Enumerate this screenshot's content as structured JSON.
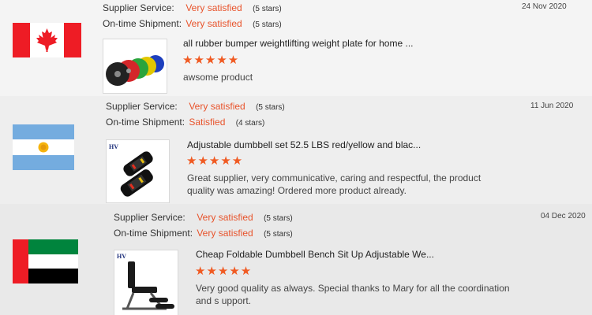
{
  "reviews": [
    {
      "country": "Canada",
      "supplier_label": "Supplier Service:",
      "supplier_value": "Very satisfied",
      "supplier_stars": "(5 stars)",
      "shipment_label": "On-time Shipment:",
      "shipment_value": "Very satisfied",
      "shipment_stars": "(5 stars)",
      "date": "24 Nov 2020",
      "product_title": "all rubber bumper weightlifting weight plate for home ...",
      "rating_stars": "★★★★★",
      "comment": "awsome product",
      "thumb_icon": "weight-plates"
    },
    {
      "country": "Argentina",
      "supplier_label": "Supplier Service:",
      "supplier_value": "Very satisfied",
      "supplier_stars": "(5 stars)",
      "shipment_label": "On-time Shipment:",
      "shipment_value": "Satisfied",
      "shipment_stars": "(4 stars)",
      "date": "11 Jun 2020",
      "product_title": "Adjustable dumbbell set 52.5 LBS red/yellow and blac...",
      "rating_stars": "★★★★★",
      "comment": "Great supplier, very communicative, caring and respectful, the product quality was amazing! Ordered more product already.",
      "thumb_brand": "HV",
      "thumb_icon": "dumbbells"
    },
    {
      "country": "United Arab Emirates",
      "supplier_label": "Supplier Service:",
      "supplier_value": "Very satisfied",
      "supplier_stars": "(5 stars)",
      "shipment_label": "On-time Shipment:",
      "shipment_value": "Very satisfied",
      "shipment_stars": "(5 stars)",
      "date": "04 Dec 2020",
      "product_title": "Cheap Foldable Dumbbell Bench Sit Up Adjustable We...",
      "rating_stars": "★★★★★",
      "comment": "Very good quality as always. Special thanks to Mary for all the coordination and s upport.",
      "thumb_brand": "HV",
      "thumb_icon": "weight-bench"
    }
  ],
  "colors": {
    "accent": "#e8532b",
    "star": "#f05a22",
    "canada_red": "#ee1c25",
    "argentina_blue": "#74acdf",
    "uae_green": "#00843d",
    "uae_red": "#ee1c25"
  }
}
